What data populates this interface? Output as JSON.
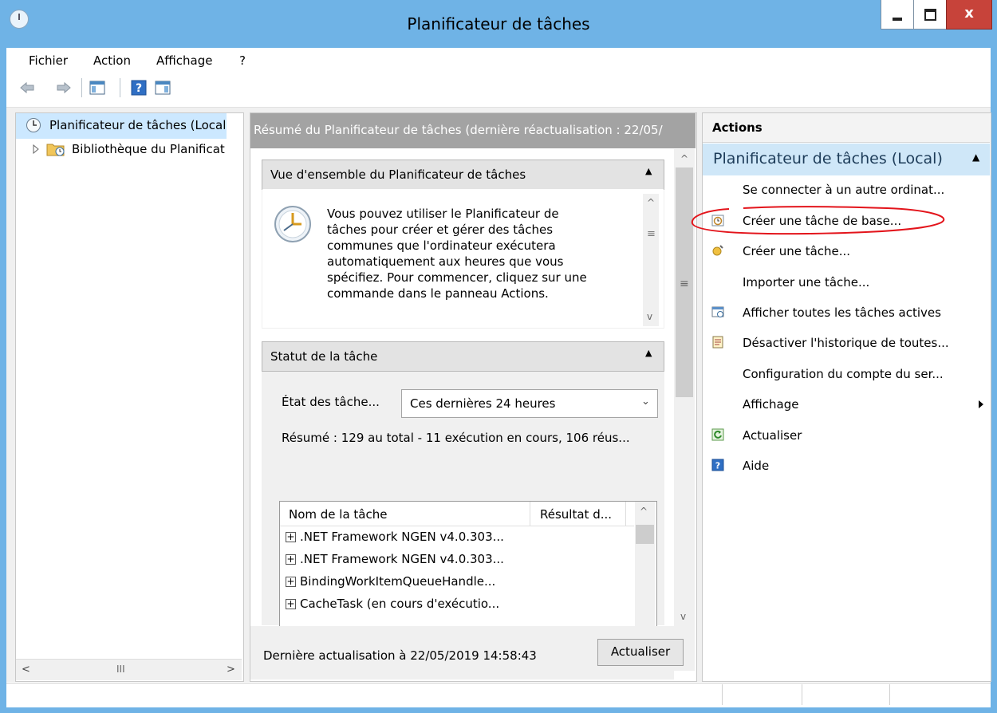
{
  "window": {
    "title": "Planificateur de tâches",
    "close_glyph": "x"
  },
  "menu": [
    "Fichier",
    "Action",
    "Affichage",
    "?"
  ],
  "tree": {
    "root": "Planificateur de tâches (Local",
    "child": "Bibliothèque du Planificat"
  },
  "scroll_glyphs": {
    "left": "<",
    "right": ">",
    "thumb": "III",
    "up": "^",
    "down": "v",
    "grip": "≡"
  },
  "middle": {
    "header": "Résumé du Planificateur de tâches (dernière réactualisation : 22/05/",
    "overview": {
      "title": "Vue d'ensemble du Planificateur de tâches",
      "lines": [
        "Vous pouvez utiliser le Planificateur de",
        "tâches pour créer et gérer des tâches",
        "communes que l'ordinateur exécutera",
        "automatiquement aux heures que vous",
        "spécifiez. Pour commencer, cliquez sur une",
        "commande dans le panneau Actions."
      ]
    },
    "status": {
      "title": "Statut de la tâche",
      "state_label": "État des tâche...",
      "state_value": "Ces dernières 24 heures",
      "summary": "Résumé : 129 au total - 11 exécution en cours, 106 réus...",
      "columns": [
        "Nom de la tâche",
        "Résultat d..."
      ],
      "rows": [
        ".NET Framework NGEN v4.0.303...",
        ".NET Framework NGEN v4.0.303...",
        "BindingWorkItemQueueHandle...",
        "CacheTask (en cours d'exécutio..."
      ]
    },
    "footer": {
      "last_refresh": "Dernière actualisation à 22/05/2019 14:58:43",
      "refresh_button": "Actualiser"
    }
  },
  "actions": {
    "header": "Actions",
    "group": "Planificateur de tâches (Local)",
    "items": [
      "Se connecter à un autre ordinat...",
      "Créer une tâche de base...",
      "Créer une tâche...",
      "Importer une tâche...",
      "Afficher toutes les tâches actives",
      "Désactiver l'historique de toutes...",
      "Configuration du compte du ser...",
      "Affichage",
      "Actualiser",
      "Aide"
    ]
  },
  "colors": {
    "annotation": "#e3141b",
    "accent": "#6fb3e6",
    "selection": "#cce8ff"
  }
}
